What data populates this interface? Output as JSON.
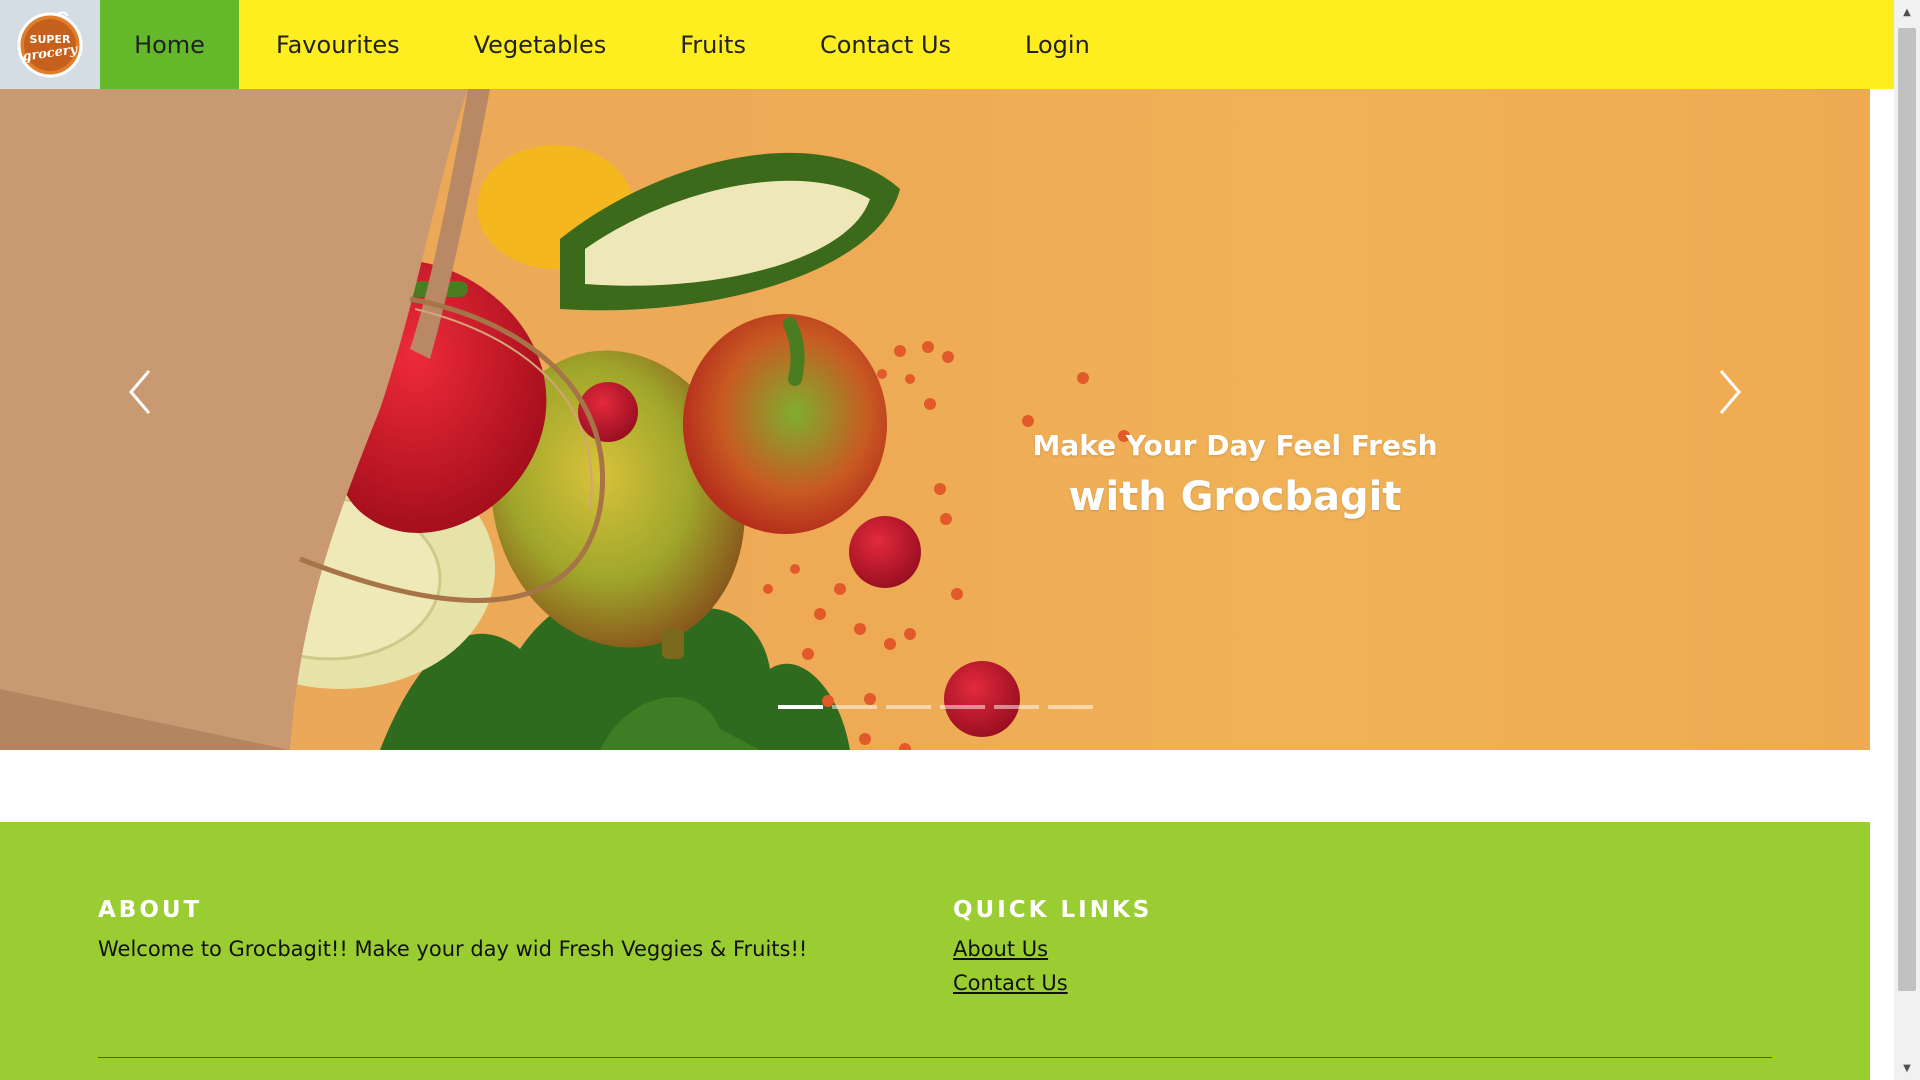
{
  "brand": {
    "logo_line1": "SUPER",
    "logo_line2": "grocery"
  },
  "nav": {
    "items": [
      {
        "label": "Home",
        "active": true
      },
      {
        "label": "Favourites"
      },
      {
        "label": "Vegetables"
      },
      {
        "label": "Fruits"
      },
      {
        "label": "Contact Us"
      },
      {
        "label": "Login"
      }
    ]
  },
  "hero": {
    "caption_line1": "Make Your Day Feel Fresh",
    "caption_line2": "with Grocbagit",
    "prev_icon": "chevron-left-icon",
    "next_icon": "chevron-right-icon",
    "slide_count": 6,
    "active_slide": 1
  },
  "footer": {
    "about_heading": "ABOUT",
    "about_text": "Welcome to Grocbagit!! Make your day wid Fresh Veggies & Fruits!!",
    "links_heading": "QUICK LINKS",
    "links": [
      "About Us",
      "Contact Us"
    ]
  },
  "colors": {
    "navbar": "#ffee1f",
    "nav_active": "#64b92b",
    "hero_bg": "#eeaa55",
    "footer": "#9acd32"
  }
}
